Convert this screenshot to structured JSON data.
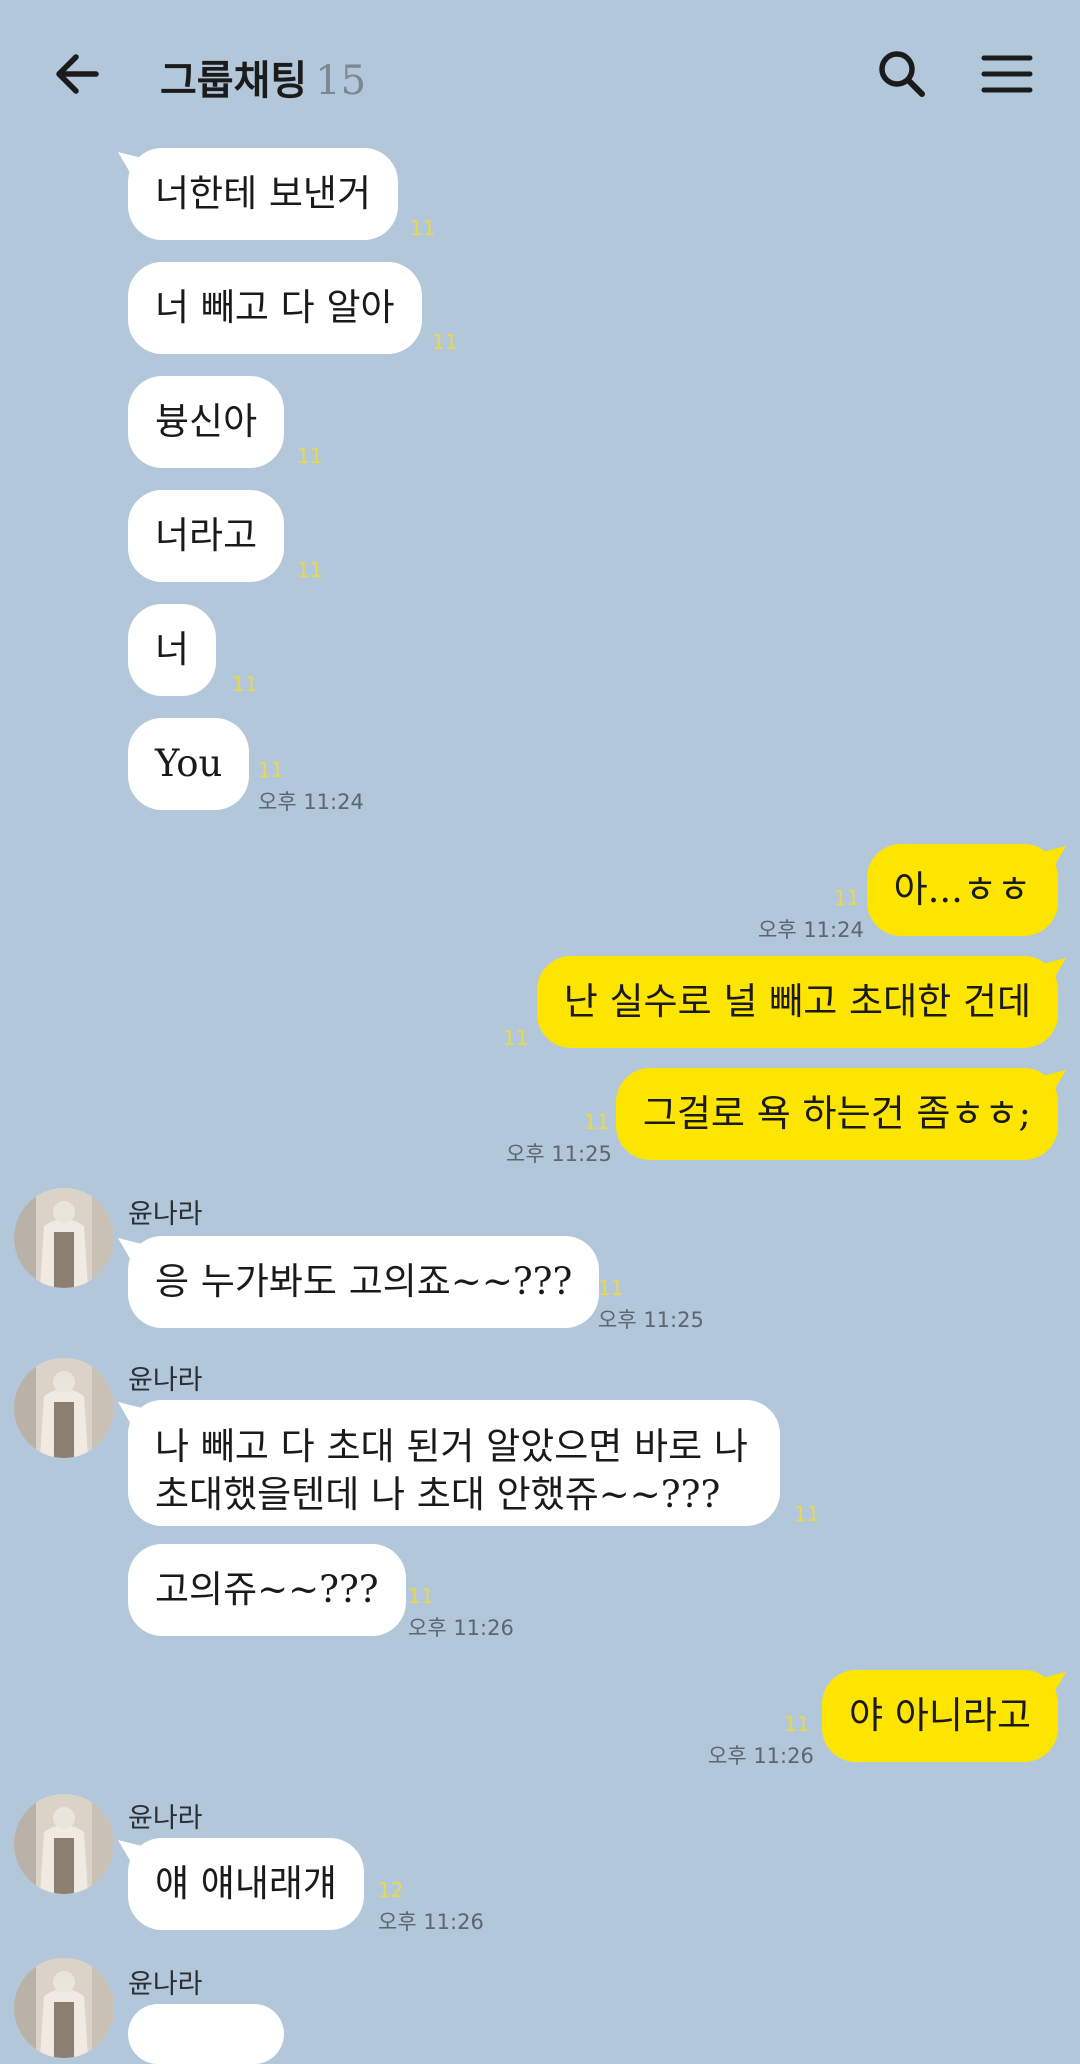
{
  "header": {
    "title": "그룹채팅",
    "count": "15",
    "back_icon": "arrow-left-icon",
    "search_icon": "search-icon",
    "menu_icon": "hamburger-menu-icon"
  },
  "colors": {
    "background": "#b2c7da",
    "incoming_bubble": "#ffffff",
    "outgoing_bubble": "#fee500",
    "unread_count": "#e8d84a"
  },
  "messages": [
    {
      "direction": "in",
      "text": "너한테 보낸거",
      "unread": "11",
      "time": ""
    },
    {
      "direction": "in",
      "text": "너 빼고 다 알아",
      "unread": "11",
      "time": ""
    },
    {
      "direction": "in",
      "text": "븅신아",
      "unread": "11",
      "time": ""
    },
    {
      "direction": "in",
      "text": "너라고",
      "unread": "11",
      "time": ""
    },
    {
      "direction": "in",
      "text": "너",
      "unread": "11",
      "time": ""
    },
    {
      "direction": "in",
      "text": "You",
      "unread": "11",
      "time": "오후 11:24"
    },
    {
      "direction": "out",
      "text": "아...ㅎㅎ",
      "unread": "11",
      "time": "오후 11:24"
    },
    {
      "direction": "out",
      "text": "난 실수로 널 빼고 초대한 건데",
      "unread": "11",
      "time": ""
    },
    {
      "direction": "out",
      "text": "그걸로 욕 하는건 좀ㅎㅎ;",
      "unread": "11",
      "time": "오후 11:25"
    },
    {
      "direction": "in",
      "sender": "윤나라",
      "text": "응 누가봐도 고의죠~~???",
      "unread": "11",
      "time": "오후 11:25"
    },
    {
      "direction": "in",
      "sender": "윤나라",
      "text": "나 빼고 다 초대 된거 알았으면 바로 나 초대했을텐데 나 초대 안했쥬~~???",
      "unread": "11",
      "time": ""
    },
    {
      "direction": "in",
      "text": "고의쥬~~???",
      "unread": "11",
      "time": "오후 11:26"
    },
    {
      "direction": "out",
      "text": "야 아니라고",
      "unread": "11",
      "time": "오후 11:26"
    },
    {
      "direction": "in",
      "sender": "윤나라",
      "text": "얘 얘내래걔",
      "unread": "12",
      "time": "오후 11:26"
    },
    {
      "direction": "in",
      "sender": "윤나라",
      "text": "",
      "unread": "",
      "time": ""
    }
  ]
}
